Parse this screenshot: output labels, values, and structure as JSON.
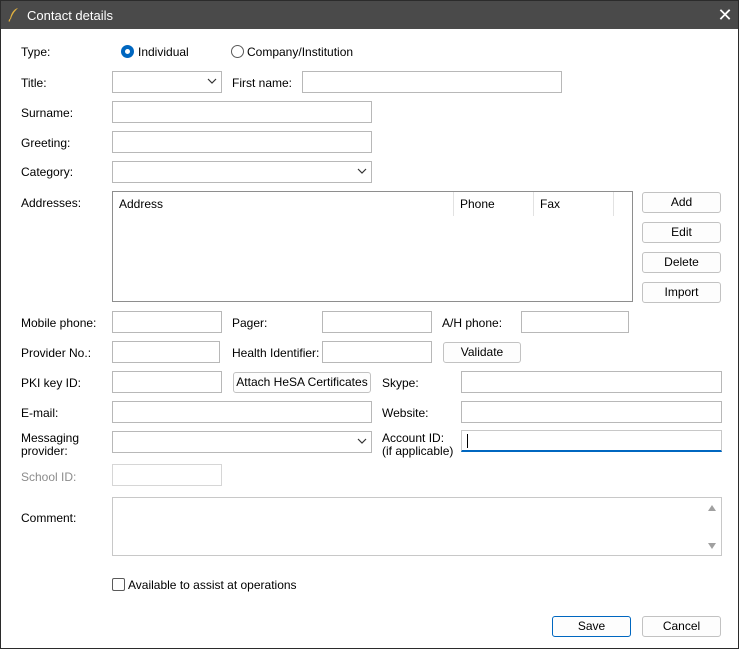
{
  "window": {
    "title": "Contact details",
    "close_glyph": "✕",
    "icon": "feather-icon"
  },
  "type": {
    "label": "Type:",
    "options": [
      {
        "label": "Individual",
        "selected": true
      },
      {
        "label": "Company/Institution",
        "selected": false
      }
    ]
  },
  "labels": {
    "title": "Title:",
    "first_name": "First name:",
    "surname": "Surname:",
    "greeting": "Greeting:",
    "category": "Category:",
    "addresses": "Addresses:",
    "mobile_phone": "Mobile phone:",
    "pager": "Pager:",
    "ah_phone": "A/H phone:",
    "provider_no": "Provider No.:",
    "health_identifier": "Health Identifier:",
    "pki_key_id": "PKI key ID:",
    "skype": "Skype:",
    "email": "E-mail:",
    "website": "Website:",
    "messaging_provider": "Messaging provider:",
    "account_id": "Account ID: (if applicable)",
    "school_id": "School ID:",
    "comment": "Comment:"
  },
  "addresses_table": {
    "columns": [
      "Address",
      "Phone",
      "Fax"
    ],
    "rows": []
  },
  "address_buttons": {
    "add": "Add",
    "edit": "Edit",
    "delete": "Delete",
    "import": "Import"
  },
  "buttons": {
    "validate": "Validate",
    "attach_hesa": "Attach HeSA Certificates",
    "save": "Save",
    "cancel": "Cancel"
  },
  "checkbox": {
    "label": "Available to assist at operations",
    "checked": false
  },
  "values": {
    "title": "",
    "first_name": "",
    "surname": "",
    "greeting": "",
    "category": "",
    "mobile_phone": "",
    "pager": "",
    "ah_phone": "",
    "provider_no": "",
    "health_identifier": "",
    "pki_key_id": "",
    "skype": "",
    "email": "",
    "website": "",
    "messaging_provider": "",
    "account_id": "",
    "school_id": "",
    "comment": ""
  },
  "colors": {
    "titlebar": "#4a4a4a",
    "accent": "#0067c0",
    "border": "#b8b8b8"
  }
}
